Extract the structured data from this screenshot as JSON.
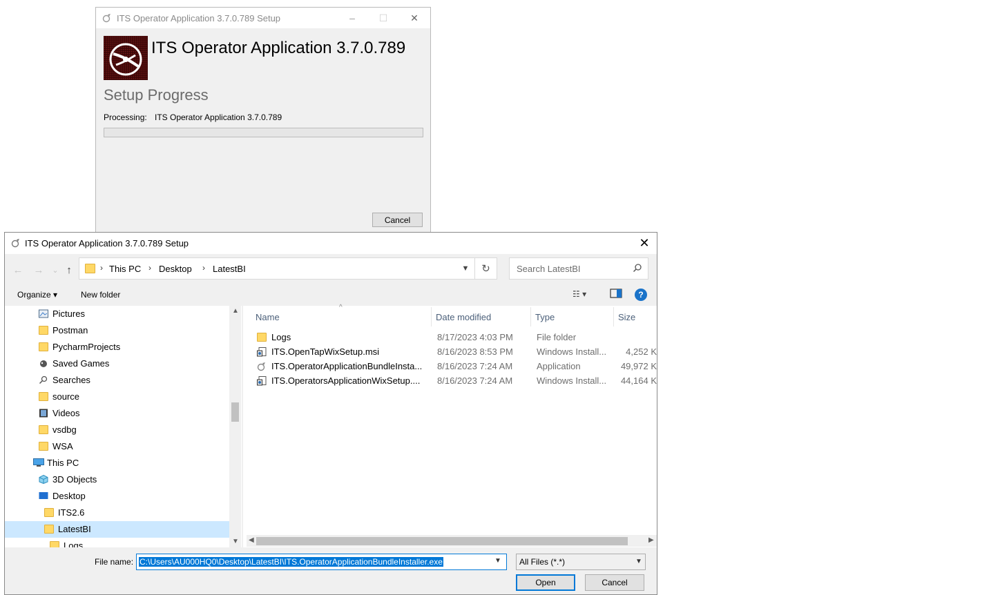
{
  "setup_window": {
    "title": "ITS Operator Application 3.7.0.789 Setup",
    "heading": "ITS Operator Application 3.7.0.789",
    "progress_title": "Setup Progress",
    "processing_label": "Processing:",
    "processing_value": "ITS Operator Application 3.7.0.789",
    "progress_percent": 0,
    "cancel_label": "Cancel",
    "controls": {
      "minimize": "–",
      "maximize": "☐",
      "close": "✕"
    }
  },
  "file_dialog": {
    "title": "ITS Operator Application 3.7.0.789 Setup",
    "close": "✕",
    "nav": {
      "back": "←",
      "forward": "→",
      "recent": "⌄",
      "up": "↑"
    },
    "breadcrumb": [
      "This PC",
      "Desktop",
      "LatestBI"
    ],
    "refresh": "↻",
    "search_placeholder": "Search LatestBI",
    "toolbar": {
      "organize_label": "Organize ▾",
      "new_folder_label": "New folder",
      "view_label": "☷ ▾",
      "help_label": "?"
    },
    "tree": [
      {
        "label": "Pictures",
        "icon": "pictures-icon",
        "indent": 1
      },
      {
        "label": "Postman",
        "icon": "folder-icon",
        "indent": 1
      },
      {
        "label": "PycharmProjects",
        "icon": "folder-icon",
        "indent": 1
      },
      {
        "label": "Saved Games",
        "icon": "saved-games-icon",
        "indent": 1
      },
      {
        "label": "Searches",
        "icon": "search-folder-icon",
        "indent": 1
      },
      {
        "label": "source",
        "icon": "folder-icon",
        "indent": 1
      },
      {
        "label": "Videos",
        "icon": "videos-icon",
        "indent": 1
      },
      {
        "label": "vsdbg",
        "icon": "folder-icon",
        "indent": 1
      },
      {
        "label": "WSA",
        "icon": "folder-icon",
        "indent": 1
      },
      {
        "label": "This PC",
        "icon": "computer-icon",
        "indent": 0
      },
      {
        "label": "3D Objects",
        "icon": "3d-objects-icon",
        "indent": 1
      },
      {
        "label": "Desktop",
        "icon": "desktop-icon",
        "indent": 1
      },
      {
        "label": "ITS2.6",
        "icon": "folder-icon",
        "indent": 2
      },
      {
        "label": "LatestBI",
        "icon": "folder-icon",
        "indent": 2,
        "selected": true
      },
      {
        "label": "Logs",
        "icon": "folder-icon",
        "indent": 3
      }
    ],
    "columns": {
      "name": "Name",
      "date": "Date modified",
      "type": "Type",
      "size": "Size"
    },
    "files": [
      {
        "name": "Logs",
        "date": "8/17/2023 4:03 PM",
        "type": "File folder",
        "size": "",
        "icon": "folder-icon"
      },
      {
        "name": "ITS.OpenTapWixSetup.msi",
        "date": "8/16/2023 8:53 PM",
        "type": "Windows Install...",
        "size": "4,252 K",
        "icon": "msi-icon"
      },
      {
        "name": "ITS.OperatorApplicationBundleInsta...",
        "date": "8/16/2023 7:24 AM",
        "type": "Application",
        "size": "49,972 K",
        "icon": "app-icon"
      },
      {
        "name": "ITS.OperatorsApplicationWixSetup....",
        "date": "8/16/2023 7:24 AM",
        "type": "Windows Install...",
        "size": "44,164 K",
        "icon": "msi-icon"
      }
    ],
    "file_name_label": "File name:",
    "file_name_value": "C:\\Users\\AU000HQ0\\Desktop\\LatestBI\\ITS.OperatorApplicationBundleInstaller.exe",
    "file_type_value": "All Files (*.*)",
    "open_label": "Open",
    "cancel_label": "Cancel"
  },
  "colors": {
    "accent": "#0078d7",
    "selection": "#cce8ff",
    "logo_bg": "#5a0f0f",
    "folder": "#ffd866"
  }
}
